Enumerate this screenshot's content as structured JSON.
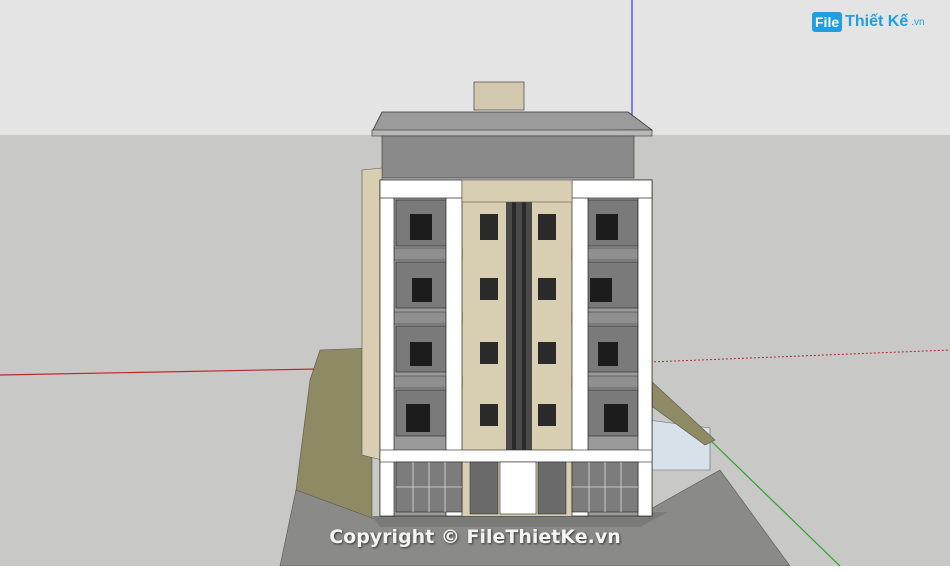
{
  "logo": {
    "badge": "File",
    "name": "Thiết Kế",
    "suffix": ".vn"
  },
  "watermark": "Copyright © FileThietKe.vn",
  "colors": {
    "sky": "#e6e6e6",
    "ground": "#c9c9c6",
    "road": "#8c8c8a",
    "facade_white": "#ffffff",
    "facade_beige": "#d9cfb4",
    "wall_gray": "#8a8a8a",
    "roof": "#9a9a9a",
    "lawn": "#8f8a63",
    "axis_red": "#c0262b",
    "axis_green": "#2aa32a",
    "axis_blue": "#3a3ad6"
  }
}
